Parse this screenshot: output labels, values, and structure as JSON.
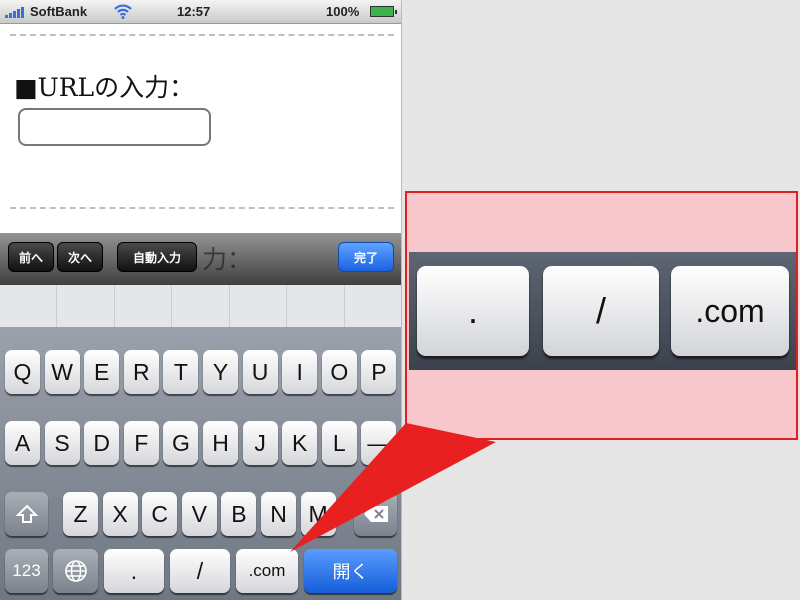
{
  "status_bar": {
    "carrier": "SoftBank",
    "time": "12:57",
    "battery_percent": "100%",
    "battery_level": 1.0,
    "icons": [
      "signal-icon",
      "wifi-icon",
      "battery-icon"
    ]
  },
  "form": {
    "url_label": "■URLの入力：",
    "url_input_value": "",
    "next_label_partial": "力："
  },
  "toolbar": {
    "prev_label": "前へ",
    "next_label": "次へ",
    "autofill_label": "自動入力",
    "done_label": "完了"
  },
  "keyboard": {
    "row1": [
      "Q",
      "W",
      "E",
      "R",
      "T",
      "Y",
      "U",
      "I",
      "O",
      "P"
    ],
    "row2": [
      "A",
      "S",
      "D",
      "F",
      "G",
      "H",
      "J",
      "K",
      "L",
      "―"
    ],
    "row3": [
      "Z",
      "X",
      "C",
      "V",
      "B",
      "N",
      "M"
    ],
    "bottom": {
      "numbers_label": "123",
      "dot_label": ".",
      "slash_label": "/",
      "dotcom_label": ".com",
      "open_label": "開く"
    }
  },
  "callout": {
    "keys": [
      ".",
      "/",
      ".com"
    ]
  },
  "colors": {
    "callout_fill": "#f7c7cb",
    "callout_border": "#e02020",
    "pointer": "#e82020",
    "done_button": "#1c62e0",
    "open_key": "#155ed8"
  }
}
